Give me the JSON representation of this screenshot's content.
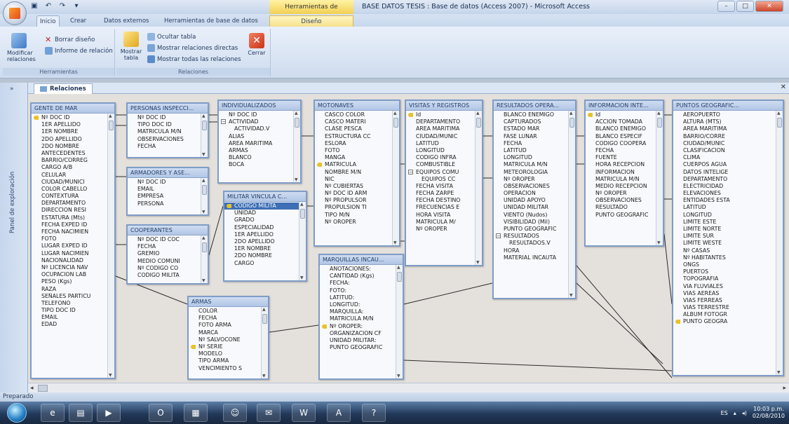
{
  "app": {
    "title": "BASE DATOS TESIS : Base de datos (Access 2007) - Microsoft Access",
    "context_tab": "Herramientas de relaciones"
  },
  "ribbon": {
    "tabs": [
      "Inicio",
      "Crear",
      "Datos externos",
      "Herramientas de base de datos",
      "Diseño"
    ],
    "groups": {
      "herramientas": {
        "label": "Herramientas",
        "modificar": "Modificar relaciones",
        "borrar": "Borrar diseño",
        "informe": "Informe de relación"
      },
      "relaciones": {
        "label": "Relaciones",
        "mostrar_tabla": "Mostrar tabla",
        "ocultar": "Ocultar tabla",
        "directas": "Mostrar relaciones directas",
        "todas": "Mostrar todas las relaciones",
        "cerrar": "Cerrar"
      }
    }
  },
  "nav": {
    "label": "Panel de exploración"
  },
  "document": {
    "tab_label": "Relaciones"
  },
  "status": {
    "text": "Preparado"
  },
  "tray": {
    "lang": "ES",
    "time": "10:03 p.m.",
    "date": "02/08/2010"
  },
  "tables": {
    "gente": {
      "title": "GENTE DE MAR",
      "fields": [
        "Nº DOC ID",
        "1ER APELLIDO",
        "1ER NOMBRE",
        "2DO APELLIDO",
        "2DO NOMBRE",
        "ANTECEDENTES",
        "BARRIO/CORREG",
        "CARGO A/B",
        "CELULAR",
        "CIUDAD/MUNICI",
        "COLOR CABELLO",
        "CONTEXTURA",
        "DEPARTAMENTO",
        "DIRECCION RESI",
        "ESTATURA (Mts)",
        "FECHA EXPED ID",
        "FECHA NACIMIEN",
        "FOTO",
        "LUGAR EXPED ID",
        "LUGAR NACIMIEN",
        "NACIONALIDAD",
        "Nº LICENCIA NAV",
        "OCUPACION LAB",
        "PESO (Kgs)",
        "RAZA",
        "SEÑALES PARTICU",
        "TELEFONO",
        "TIPO DOC ID",
        "EMAIL",
        "EDAD"
      ]
    },
    "personas": {
      "title": "PERSONAS INSPECCI...",
      "fields": [
        "Nº DOC ID",
        "TIPO DOC ID",
        "MATRICULA M/N",
        "OBSERVACIONES",
        "FECHA"
      ]
    },
    "armadores": {
      "title": "ARMADORES Y ASE...",
      "fields": [
        "Nº DOC ID",
        "EMAIL",
        "EMPRESA",
        "PERSONA"
      ]
    },
    "cooperantes": {
      "title": "COOPERANTES",
      "fields": [
        "Nº DOC ID COC",
        "FECHA",
        "GREMIO",
        "MEDIO COMUNI",
        "Nº CODIGO CO",
        "CODIGO MILITA"
      ]
    },
    "individualizados": {
      "title": "INDIVIDUALIZADOS",
      "fields": [
        "Nº DOC ID",
        "ACTIVIDAD",
        "ACTIVIDAD.V",
        "ALIAS",
        "AREA MARITIMA",
        "ARMAS",
        "BLANCO",
        "BOCA"
      ]
    },
    "militar": {
      "title": "MILITAR VINCULA C...",
      "fields": [
        "CODIGO MILITA",
        "UNIDAD",
        "GRADO",
        "ESPECIALIDAD",
        "1ER APELLIDO",
        "2DO APELLIDO",
        "1ER NOMBRE",
        "2DO NOMBRE",
        "CARGO"
      ]
    },
    "armas": {
      "title": "ARMAS",
      "fields": [
        "COLOR",
        "FECHA",
        "FOTO ARMA",
        "MARCA",
        "Nº SALVOCONE",
        "Nº SERIE",
        "MODELO",
        "TIPO ARMA",
        "VENCIMIENTO S"
      ]
    },
    "motonaves": {
      "title": "MOTONAVES",
      "fields": [
        "CASCO COLOR",
        "CASCO MATERI",
        "CLASE PESCA",
        "ESTRUCTURA CC",
        "ESLORA",
        "FOTO",
        "MANGA",
        "MATRICULA",
        "NOMBRE M/N",
        "NIC",
        "Nº CUBIERTAS",
        "Nº DOC ID ARM",
        "Nº PROPULSOR",
        "PROPULSION TI",
        "TIPO M/N",
        "Nº OROPER"
      ]
    },
    "marquillas": {
      "title": "MARQUILLAS INCAU...",
      "fields": [
        "ANOTACIONES:",
        "CANTIDAD (Kgs)",
        "FECHA:",
        "FOTO:",
        "LATITUD:",
        "LONGITUD:",
        "MARQUILLA:",
        "MATRICULA M/N",
        "Nº OROPER:",
        "ORGANIZACION CF",
        "UNIDAD MILITAR:",
        "PUNTO GEOGRAFIC"
      ]
    },
    "visitas": {
      "title": "VISITAS Y REGISTROS",
      "fields": [
        "Id",
        "DEPARTAMENTO",
        "AREA MARITIMA",
        "CIUDAD/MUNIC",
        "LATITUD",
        "LONGITUD",
        "CODIGO INFRA",
        "COMBUSTIBLE",
        "EQUIPOS COMU",
        "EQUIPOS CC",
        "FECHA VISITA",
        "FECHA ZARPE",
        "FECHA DESTINO",
        "FRECUENCIAS E",
        "HORA VISITA",
        "MATRICULA M/",
        "Nº OROPER"
      ]
    },
    "resultados": {
      "title": "RESULTADOS OPERA...",
      "fields": [
        "BLANCO ENEMIGO",
        "CAPTURADOS",
        "ESTADO MAR",
        "FASE LUNAR",
        "FECHA",
        "LATITUD",
        "LONGITUD",
        "MATRICULA M/N",
        "METEOROLOGIA",
        "Nº OROPER",
        "OBSERVACIONES",
        "OPERACION",
        "UNIDAD APOYO",
        "UNIDAD MILITAR",
        "VIENTO (Nudos)",
        "VISIBILIDAD (Mil)",
        "PUNTO GEOGRAFIC",
        "RESULTADOS",
        "RESULTADOS.V",
        "HORA",
        "MATERIAL INCAUTA"
      ]
    },
    "informacion": {
      "title": "INFORMACION INTE...",
      "fields": [
        "Id",
        "ACCION TOMADA",
        "BLANCO ENEMIGO",
        "BLANCO ESPECIF",
        "CODIGO COOPERA",
        "FECHA",
        "FUENTE",
        "HORA RECEPCION",
        "INFORMACION",
        "MATRICULA M/N",
        "MEDIO RECEPCION",
        "Nº OROPER",
        "OBSERVACIONES",
        "RESULTADO",
        "PUNTO GEOGRAFIC"
      ]
    },
    "puntos": {
      "title": "PUNTOS GEOGRAFIC...",
      "fields": [
        "AEROPUERTO",
        "ALTURA (MTS)",
        "AREA MARITIMA",
        "BARRIO/CORRE",
        "CIUDAD/MUNIC",
        "CLASIFICACION",
        "CLIMA",
        "CUERPOS AGUA",
        "DATOS INTELIGE",
        "DEPARTAMENTO",
        "ELECTRICIDAD",
        "ELEVACIONES",
        "ENTIDADES ESTA",
        "LATITUD",
        "LONGITUD",
        "LIMITE ESTE",
        "LIMITE NORTE",
        "LIMITE SUR",
        "LIMITE WESTE",
        "Nº CASAS",
        "Nº HABITANTES",
        "ONGS",
        "PUERTOS",
        "TOPOGRAFIA",
        "VIA FLUVIALES",
        "VIAS AEREAS",
        "VIAS FERREAS",
        "VIAS TERRESTRE",
        "ALBUM FOTOGR",
        "PUNTO GEOGRA"
      ]
    }
  }
}
